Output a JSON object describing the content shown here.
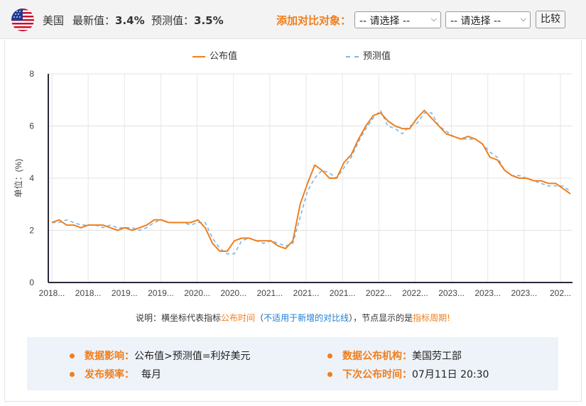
{
  "header": {
    "country": "美国",
    "latest_label": "最新值：",
    "latest_value": "3.4%",
    "forecast_label": "预测值：",
    "forecast_value": "3.5%",
    "add_compare_label": "添加对比对象：",
    "select1_value": "-- 请选择 --",
    "select2_value": "-- 请选择 --",
    "compare_button": "比较",
    "flag_icon": "us-flag-icon"
  },
  "legend": {
    "published": "公布值",
    "forecast": "预测值"
  },
  "colors": {
    "published": "#f07e1c",
    "forecast": "#7cb5e8",
    "accent": "#f07e1c",
    "link_blue": "#1a7ed6",
    "info_bg": "#eef3fa"
  },
  "chart_data": {
    "type": "line",
    "ylabel": "单位：(%)",
    "ylim": [
      0,
      8
    ],
    "yticks": [
      "0",
      "2",
      "4",
      "6",
      "8"
    ],
    "xtick_labels": [
      "2018...",
      "2018...",
      "2019...",
      "2019...",
      "2020...",
      "2020...",
      "2021...",
      "2021...",
      "2021...",
      "2022...",
      "2022...",
      "2023...",
      "2023...",
      "2023...",
      "202..."
    ],
    "grid": true,
    "legend_position": "top-center",
    "series": [
      {
        "name": "公布值",
        "style": "solid",
        "values": [
          2.3,
          2.4,
          2.2,
          2.2,
          2.1,
          2.2,
          2.2,
          2.2,
          2.1,
          2.0,
          2.1,
          2.0,
          2.1,
          2.2,
          2.4,
          2.4,
          2.3,
          2.3,
          2.3,
          2.3,
          2.4,
          2.1,
          1.5,
          1.2,
          1.2,
          1.6,
          1.7,
          1.7,
          1.6,
          1.6,
          1.6,
          1.4,
          1.3,
          1.6,
          3.0,
          3.8,
          4.5,
          4.3,
          4.0,
          4.0,
          4.6,
          4.9,
          5.5,
          6.0,
          6.4,
          6.5,
          6.2,
          6.0,
          5.9,
          5.9,
          6.3,
          6.6,
          6.3,
          6.0,
          5.7,
          5.6,
          5.5,
          5.6,
          5.5,
          5.3,
          4.8,
          4.7,
          4.3,
          4.1,
          4.0,
          4.0,
          3.9,
          3.9,
          3.8,
          3.8,
          3.6,
          3.4
        ]
      },
      {
        "name": "预测值",
        "style": "dashed",
        "values": [
          2.3,
          2.3,
          2.4,
          2.3,
          2.2,
          2.2,
          2.2,
          2.1,
          2.2,
          2.1,
          2.1,
          2.1,
          2.0,
          2.1,
          2.3,
          2.4,
          2.3,
          2.3,
          2.3,
          2.2,
          2.3,
          2.3,
          1.7,
          1.3,
          1.1,
          1.1,
          1.6,
          1.7,
          1.6,
          1.5,
          1.6,
          1.5,
          1.4,
          1.5,
          2.5,
          3.5,
          4.0,
          4.3,
          4.2,
          4.0,
          4.4,
          4.8,
          5.4,
          5.9,
          6.3,
          6.6,
          6.0,
          5.9,
          5.7,
          6.0,
          6.1,
          6.5,
          6.5,
          6.0,
          5.8,
          5.6,
          5.5,
          5.5,
          5.5,
          5.3,
          5.0,
          4.8,
          4.3,
          4.1,
          4.1,
          4.0,
          3.9,
          3.8,
          3.7,
          3.7,
          3.7,
          3.5
        ]
      }
    ]
  },
  "note": {
    "prefix": "说明：横坐标代表指标",
    "highlight1": "公布时间",
    "paren_open": "（",
    "blue_text": "不适用于新增的对比线",
    "paren_close": "）",
    "middle": "，节点显示的是",
    "highlight2": "指标周期",
    "suffix": "!"
  },
  "info": {
    "impact_label": "数据影响：",
    "impact_value": "公布值>预测值=利好美元",
    "agency_label": "数据公布机构：",
    "agency_value": "美国劳工部",
    "frequency_label": "发布频率：",
    "frequency_value": "每月",
    "next_label": "下次公布时间：",
    "next_value": "07月11日 20:30"
  }
}
